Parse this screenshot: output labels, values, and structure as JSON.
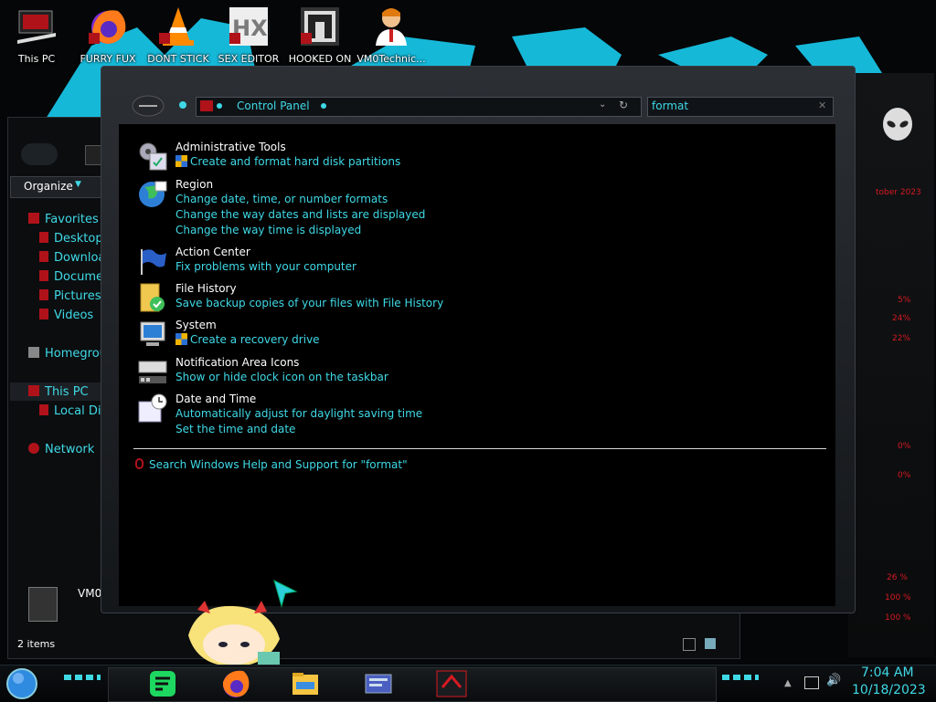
{
  "desktop_icons": [
    {
      "label": "This PC",
      "icon": "this-pc-icon"
    },
    {
      "label": "FURRY FUX",
      "icon": "firefox-icon"
    },
    {
      "label": "DONT STICK",
      "icon": "vlc-icon"
    },
    {
      "label": "SEX EDITOR",
      "icon": "hxd-icon"
    },
    {
      "label": "HOOKED ON",
      "icon": "game-icon"
    },
    {
      "label": "VM0Technic...",
      "icon": "user-icon"
    }
  ],
  "back_explorer": {
    "organize_label": "Organize",
    "nav": {
      "favorites": "Favorites",
      "desktop": "Desktop",
      "downloads": "Downloac",
      "documents": "Documen",
      "pictures": "Pictures",
      "videos": "Videos",
      "homegroup": "Homegroup",
      "this_pc": "This PC",
      "local_disk": "Local Dis",
      "network": "Network"
    },
    "selected_item": "VM0",
    "status": "2 items"
  },
  "gadget": {
    "date_text": "tober 2023",
    "readouts": [
      "5%",
      "24%",
      "22%",
      "0%",
      "0%",
      "26 %",
      "100 %",
      "100 %"
    ],
    "accent_color": "#d61a22"
  },
  "control_panel": {
    "address": "Control Panel",
    "search_value": "format",
    "results": [
      {
        "title": "Administrative Tools",
        "icon": "admin-tools-icon",
        "links": [
          {
            "text": "Create and format hard disk partitions",
            "shield": true
          }
        ]
      },
      {
        "title": "Region",
        "icon": "region-globe-icon",
        "links": [
          {
            "text": "Change date, time, or number formats"
          },
          {
            "text": "Change the way dates and lists are displayed"
          },
          {
            "text": "Change the way time is displayed"
          }
        ]
      },
      {
        "title": "Action Center",
        "icon": "action-center-flag-icon",
        "links": [
          {
            "text": "Fix problems with your computer"
          }
        ]
      },
      {
        "title": "File History",
        "icon": "file-history-icon",
        "links": [
          {
            "text": "Save backup copies of your files with File History"
          }
        ]
      },
      {
        "title": "System",
        "icon": "system-icon",
        "links": [
          {
            "text": "Create a recovery drive",
            "shield": true
          }
        ]
      },
      {
        "title": "Notification Area Icons",
        "icon": "notification-area-icon",
        "links": [
          {
            "text": "Show or hide clock icon on the taskbar"
          }
        ]
      },
      {
        "title": "Date and Time",
        "icon": "date-time-icon",
        "links": [
          {
            "text": "Automatically adjust for daylight saving time"
          },
          {
            "text": "Set the time and date"
          }
        ]
      }
    ],
    "help_search": "Search Windows Help and Support for \"format\"",
    "link_color": "#3fd9e6"
  },
  "taskbar": {
    "apps": [
      "start-orb-icon",
      "notes-app-icon",
      "firefox-icon",
      "file-explorer-icon",
      "control-panel-icon",
      "media-app-icon"
    ],
    "time": "7:04 AM",
    "date": "10/18/2023"
  }
}
